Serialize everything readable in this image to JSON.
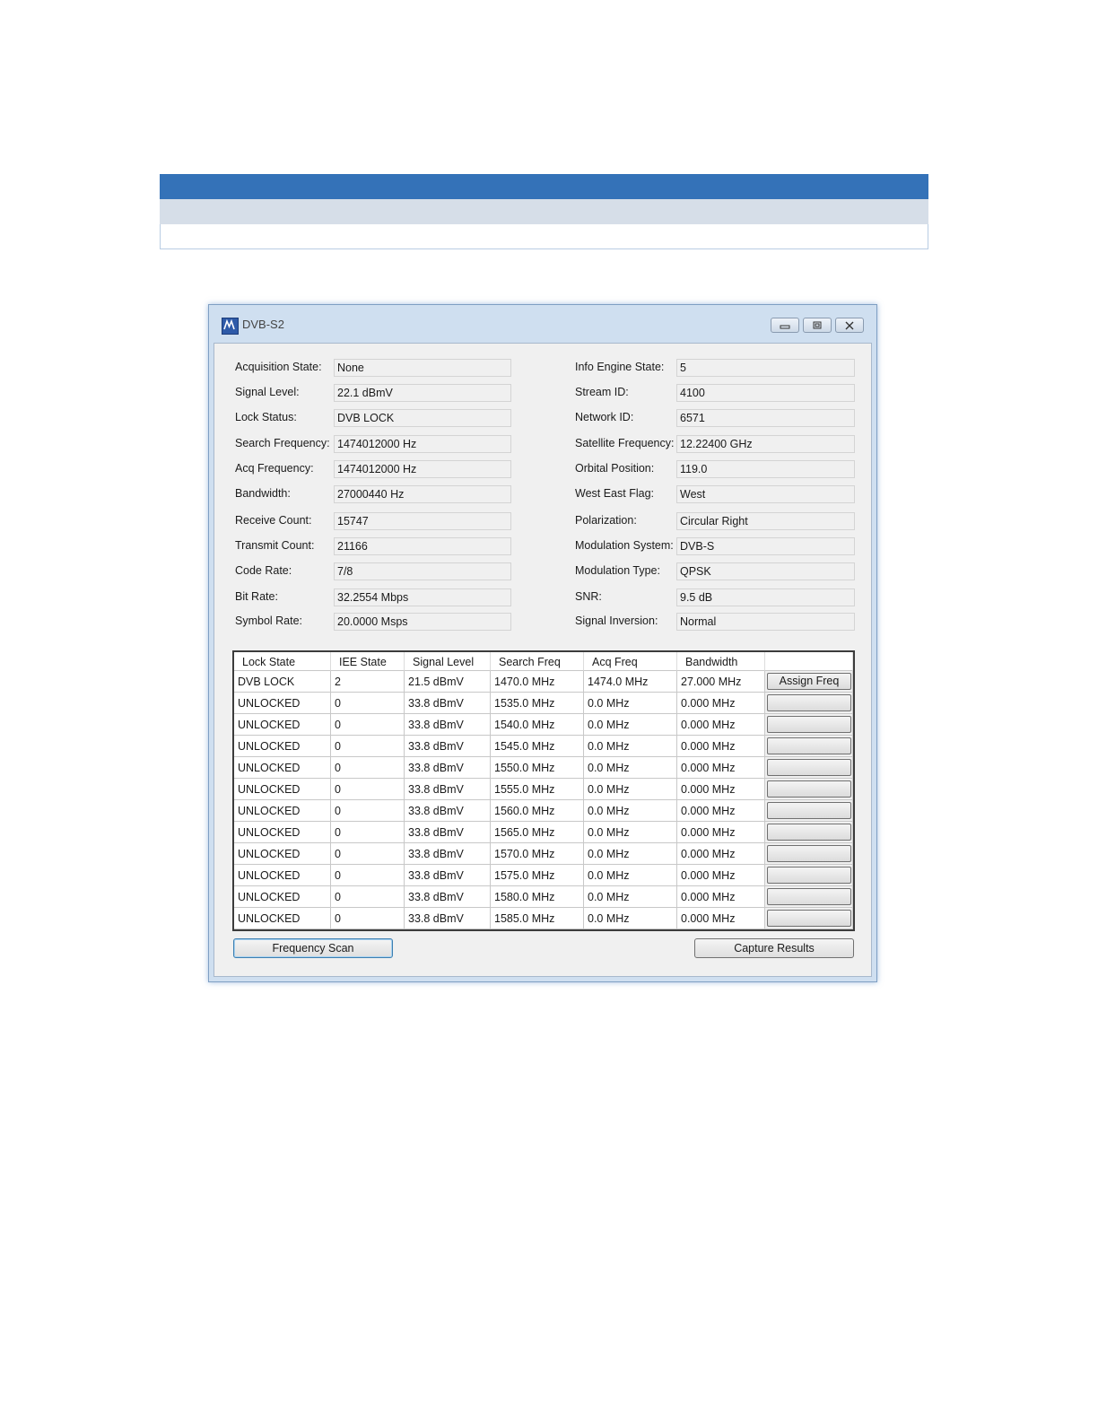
{
  "window": {
    "title": "DVB-S2"
  },
  "fields_left": [
    {
      "label": "Acquisition State:",
      "value": "None"
    },
    {
      "label": "Signal Level:",
      "value": "22.1 dBmV"
    },
    {
      "label": "Lock Status:",
      "value": "DVB LOCK"
    },
    {
      "label": "Search Frequency:",
      "value": "1474012000 Hz"
    },
    {
      "label": "Acq Frequency:",
      "value": "1474012000 Hz"
    },
    {
      "label": "Bandwidth:",
      "value": "27000440 Hz"
    },
    {
      "label": "Receive Count:",
      "value": "15747"
    },
    {
      "label": "Transmit Count:",
      "value": "21166"
    },
    {
      "label": "Code Rate:",
      "value": "7/8"
    },
    {
      "label": "Bit Rate:",
      "value": "32.2554 Mbps"
    },
    {
      "label": "Symbol Rate:",
      "value": "20.0000 Msps"
    }
  ],
  "fields_right": [
    {
      "label": "Info Engine State:",
      "value": "5"
    },
    {
      "label": "Stream ID:",
      "value": "4100"
    },
    {
      "label": "Network ID:",
      "value": "6571"
    },
    {
      "label": "Satellite Frequency:",
      "value": "12.22400 GHz"
    },
    {
      "label": "Orbital Position:",
      "value": "119.0"
    },
    {
      "label": "West East Flag:",
      "value": "West"
    },
    {
      "label": "Polarization:",
      "value": "Circular Right"
    },
    {
      "label": "Modulation System:",
      "value": "DVB-S"
    },
    {
      "label": "Modulation Type:",
      "value": "QPSK"
    },
    {
      "label": "SNR:",
      "value": "9.5 dB"
    },
    {
      "label": "Signal Inversion:",
      "value": "Normal"
    }
  ],
  "table": {
    "headers": [
      "Lock State",
      "IEE State",
      "Signal Level",
      "Search Freq",
      "Acq Freq",
      "Bandwidth",
      ""
    ],
    "rows": [
      {
        "lock_state": "DVB LOCK",
        "iee_state": "2",
        "signal_level": "21.5 dBmV",
        "search_freq": "1470.0 MHz",
        "acq_freq": "1474.0 MHz",
        "bandwidth": "27.000 MHz",
        "button": "Assign Freq"
      },
      {
        "lock_state": "UNLOCKED",
        "iee_state": "0",
        "signal_level": "33.8 dBmV",
        "search_freq": "1535.0 MHz",
        "acq_freq": "0.0 MHz",
        "bandwidth": "0.000 MHz",
        "button": ""
      },
      {
        "lock_state": "UNLOCKED",
        "iee_state": "0",
        "signal_level": "33.8 dBmV",
        "search_freq": "1540.0 MHz",
        "acq_freq": "0.0 MHz",
        "bandwidth": "0.000 MHz",
        "button": ""
      },
      {
        "lock_state": "UNLOCKED",
        "iee_state": "0",
        "signal_level": "33.8 dBmV",
        "search_freq": "1545.0 MHz",
        "acq_freq": "0.0 MHz",
        "bandwidth": "0.000 MHz",
        "button": ""
      },
      {
        "lock_state": "UNLOCKED",
        "iee_state": "0",
        "signal_level": "33.8 dBmV",
        "search_freq": "1550.0 MHz",
        "acq_freq": "0.0 MHz",
        "bandwidth": "0.000 MHz",
        "button": ""
      },
      {
        "lock_state": "UNLOCKED",
        "iee_state": "0",
        "signal_level": "33.8 dBmV",
        "search_freq": "1555.0 MHz",
        "acq_freq": "0.0 MHz",
        "bandwidth": "0.000 MHz",
        "button": ""
      },
      {
        "lock_state": "UNLOCKED",
        "iee_state": "0",
        "signal_level": "33.8 dBmV",
        "search_freq": "1560.0 MHz",
        "acq_freq": "0.0 MHz",
        "bandwidth": "0.000 MHz",
        "button": ""
      },
      {
        "lock_state": "UNLOCKED",
        "iee_state": "0",
        "signal_level": "33.8 dBmV",
        "search_freq": "1565.0 MHz",
        "acq_freq": "0.0 MHz",
        "bandwidth": "0.000 MHz",
        "button": ""
      },
      {
        "lock_state": "UNLOCKED",
        "iee_state": "0",
        "signal_level": "33.8 dBmV",
        "search_freq": "1570.0 MHz",
        "acq_freq": "0.0 MHz",
        "bandwidth": "0.000 MHz",
        "button": ""
      },
      {
        "lock_state": "UNLOCKED",
        "iee_state": "0",
        "signal_level": "33.8 dBmV",
        "search_freq": "1575.0 MHz",
        "acq_freq": "0.0 MHz",
        "bandwidth": "0.000 MHz",
        "button": ""
      },
      {
        "lock_state": "UNLOCKED",
        "iee_state": "0",
        "signal_level": "33.8 dBmV",
        "search_freq": "1580.0 MHz",
        "acq_freq": "0.0 MHz",
        "bandwidth": "0.000 MHz",
        "button": ""
      },
      {
        "lock_state": "UNLOCKED",
        "iee_state": "0",
        "signal_level": "33.8 dBmV",
        "search_freq": "1585.0 MHz",
        "acq_freq": "0.0 MHz",
        "bandwidth": "0.000 MHz",
        "button": ""
      }
    ]
  },
  "buttons": {
    "frequency_scan": "Frequency Scan",
    "capture_results": "Capture Results"
  },
  "colors": {
    "banner_blue": "#3472b8",
    "banner_light": "#d6dee8",
    "window_frame": "#cfdff0",
    "client_bg": "#f0f0f0"
  },
  "icons": {
    "app": "app-logo-icon",
    "minimize": "minimize-icon",
    "maximize": "maximize-icon",
    "close": "close-icon"
  }
}
